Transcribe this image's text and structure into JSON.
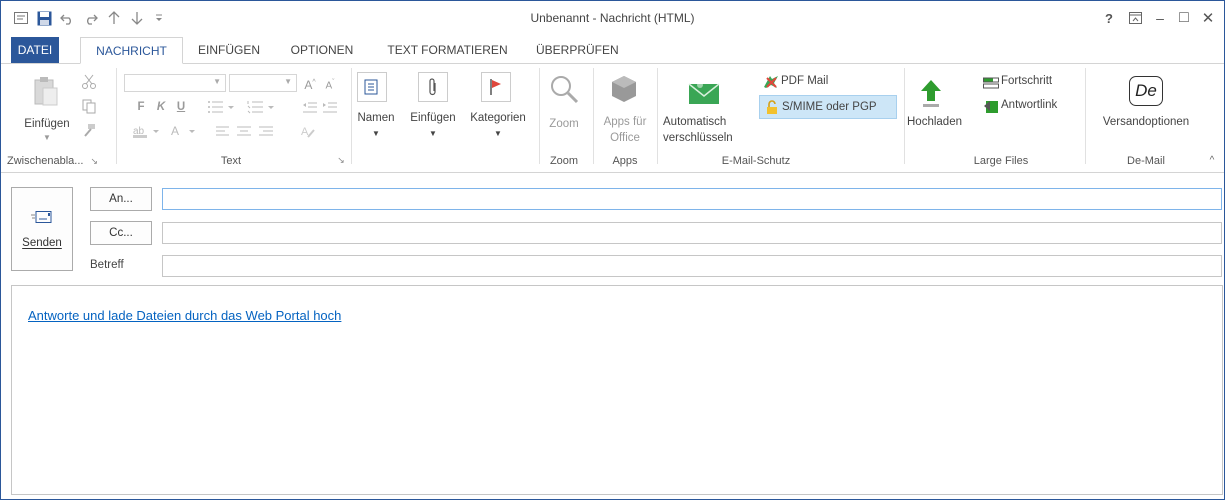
{
  "window": {
    "title": "Unbenannt - Nachricht (HTML)",
    "help": "?",
    "ribbon_display_icon": "ribbon-display-icon",
    "minimize": "–",
    "maximize": "□",
    "close": "✕"
  },
  "quick_access": {
    "icons": [
      "message-icon",
      "save-icon",
      "undo-icon",
      "redo-icon",
      "up-arrow-icon",
      "down-arrow-icon",
      "customize-icon"
    ]
  },
  "tabs": [
    {
      "label": "DATEI"
    },
    {
      "label": "NACHRICHT"
    },
    {
      "label": "EINFÜGEN"
    },
    {
      "label": "OPTIONEN"
    },
    {
      "label": "TEXT FORMATIEREN"
    },
    {
      "label": "ÜBERPRÜFEN"
    }
  ],
  "active_tab": "NACHRICHT",
  "ribbon": {
    "clipboard": {
      "paste": "Einfügen",
      "group": "Zwischenabla...",
      "launcher": "↘"
    },
    "text": {
      "bold": "F",
      "italic": "K",
      "underline": "U",
      "group": "Text",
      "launcher": "↘"
    },
    "names": {
      "label": "Namen"
    },
    "insert": {
      "label": "Einfügen"
    },
    "categories": {
      "label": "Kategorien"
    },
    "zoom": {
      "label": "Zoom",
      "group": "Zoom"
    },
    "apps": {
      "label1": "Apps für",
      "label2": "Office",
      "group": "Apps"
    },
    "encryption": {
      "auto1": "Automatisch",
      "auto2": "verschlüsseln",
      "pdf_mail": "PDF Mail",
      "smime": "S/MIME oder PGP",
      "group": "E-Mail-Schutz"
    },
    "large_files": {
      "upload": "Hochladen",
      "progress": "Fortschritt",
      "reply_link": "Antwortlink",
      "group": "Large Files"
    },
    "demail": {
      "logo": "De",
      "options": "Versandoptionen",
      "group": "De-Mail",
      "collapse": "^"
    }
  },
  "compose": {
    "send": "Senden",
    "to": "An...",
    "cc": "Cc...",
    "subject": "Betreff",
    "to_value": "",
    "cc_value": "",
    "subject_value": ""
  },
  "body": {
    "link_text": "Antworte und lade Dateien durch das Web Portal hoch"
  },
  "colors": {
    "accent": "#2b579a",
    "link": "#0563c1",
    "highlight": "#cde6f7",
    "green": "#2e9c2e"
  }
}
